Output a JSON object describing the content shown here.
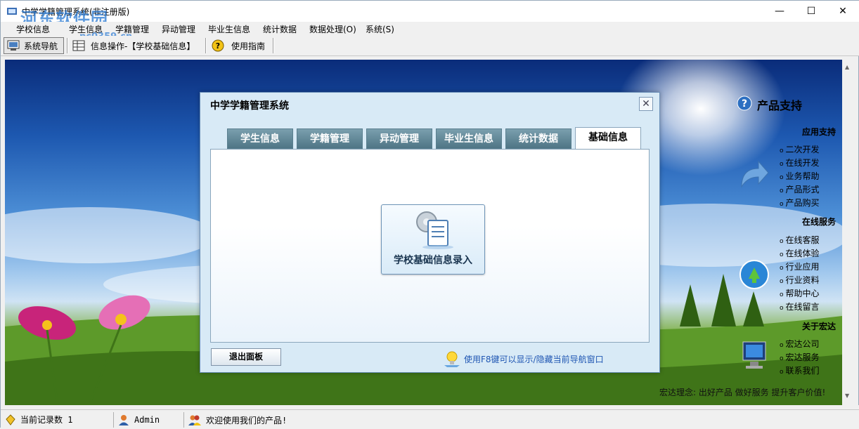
{
  "window": {
    "title": "中学学籍管理系统(非注册版)",
    "watermark": "河东软件园",
    "watermark_url": "pc0359.cn",
    "minimize_icon": "minimize-icon",
    "maximize_icon": "maximize-icon",
    "close_icon": "close-icon"
  },
  "menu": [
    {
      "label": "学校信息"
    },
    {
      "label": "学生信息"
    },
    {
      "label": "学籍管理"
    },
    {
      "label": "异动管理"
    },
    {
      "label": "毕业生信息"
    },
    {
      "label": "统计数据"
    },
    {
      "label": "数据处理(O)"
    },
    {
      "label": "系统(S)"
    }
  ],
  "toolbar": {
    "nav_label": "系统导航",
    "info_label": "信息操作-【学校基础信息】",
    "guide_label": "使用指南"
  },
  "dialog": {
    "title": "中学学籍管理系统",
    "tabs": [
      {
        "label": "学生信息"
      },
      {
        "label": "学籍管理"
      },
      {
        "label": "异动管理"
      },
      {
        "label": "毕业生信息"
      },
      {
        "label": "统计数据"
      },
      {
        "label": "基础信息"
      }
    ],
    "active_tab": "基础信息",
    "main_button": "学校基础信息录入",
    "exit_button": "退出面板",
    "hint": "使用F8键可以显示/隐藏当前导航窗口"
  },
  "side": {
    "title": "产品支持",
    "sections": [
      {
        "title": "应用支持",
        "links": [
          "二次开发",
          "在线开发",
          "业务帮助",
          "产品形式",
          "产品购买"
        ]
      },
      {
        "title": "在线服务",
        "links": [
          "在线客服",
          "在线体验",
          "行业应用",
          "行业资料",
          "帮助中心",
          "在线留言"
        ]
      },
      {
        "title": "关于宏达",
        "links": [
          "宏达公司",
          "宏达服务",
          "联系我们"
        ]
      }
    ],
    "motto": "宏达理念: 出好产品  做好服务  提升客户价值!"
  },
  "status": {
    "records": "当前记录数 1",
    "user": "Admin",
    "welcome": "欢迎使用我们的产品!"
  },
  "colors": {
    "tab_bg": "#5f8798",
    "hint_text": "#1f56b3",
    "dialog_bg": "#d8eaf6"
  }
}
